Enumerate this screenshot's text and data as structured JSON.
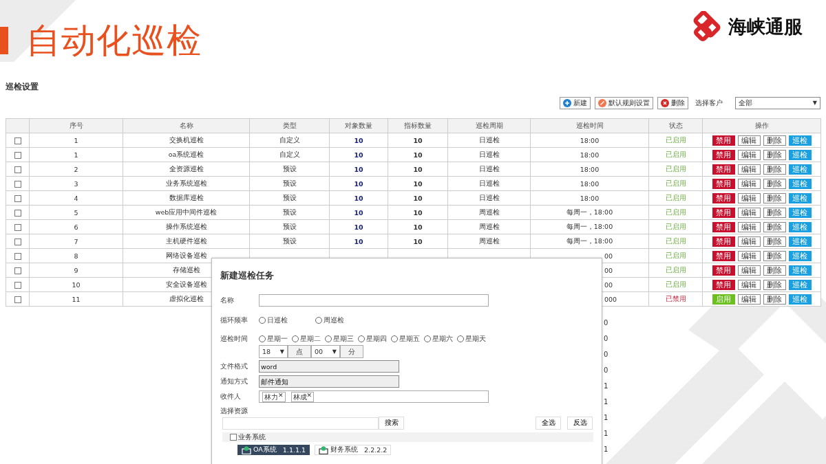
{
  "slide_title": "自动化巡检",
  "logo": {
    "text": "海峡通服"
  },
  "section_title": "巡检设置",
  "toolbar": {
    "buttons": [
      {
        "label": "新建",
        "kind": "add"
      },
      {
        "label": "默认规则设置",
        "kind": "rule"
      },
      {
        "label": "删除",
        "kind": "delete"
      }
    ],
    "customer_label": "选择客户",
    "customer_select": "全部",
    "customer_caret": "▼"
  },
  "table": {
    "columns": [
      "序号",
      "名称",
      "类型",
      "对象数量",
      "指标数量",
      "巡检周期",
      "巡检时间",
      "状态",
      "操作"
    ],
    "rows": [
      {
        "checked": false,
        "no": "1",
        "name": "交换机巡检",
        "type": "自定义",
        "objects": "10",
        "indicators": "10",
        "cycle": "日巡检",
        "time": "18:00",
        "status": "已启用",
        "enabled": true,
        "actions": [
          "禁用",
          "编辑",
          "删除",
          "巡检"
        ]
      },
      {
        "checked": false,
        "no": "1",
        "name": "oa系统巡检",
        "type": "自定义",
        "objects": "10",
        "indicators": "10",
        "cycle": "日巡检",
        "time": "18:00",
        "status": "已启用",
        "enabled": true,
        "actions": [
          "禁用",
          "编辑",
          "删除",
          "巡检"
        ]
      },
      {
        "checked": false,
        "no": "2",
        "name": "全资源巡检",
        "type": "预设",
        "objects": "10",
        "indicators": "10",
        "cycle": "日巡检",
        "time": "18:00",
        "status": "已启用",
        "enabled": true,
        "actions": [
          "禁用",
          "编辑",
          "删除",
          "巡检"
        ]
      },
      {
        "checked": false,
        "no": "3",
        "name": "业务系统巡检",
        "type": "预设",
        "objects": "10",
        "indicators": "10",
        "cycle": "日巡检",
        "time": "18:00",
        "status": "已启用",
        "enabled": true,
        "actions": [
          "禁用",
          "编辑",
          "删除",
          "巡检"
        ]
      },
      {
        "checked": false,
        "no": "4",
        "name": "数据库巡检",
        "type": "预设",
        "objects": "10",
        "indicators": "10",
        "cycle": "日巡检",
        "time": "18:00",
        "status": "已启用",
        "enabled": true,
        "actions": [
          "禁用",
          "编辑",
          "删除",
          "巡检"
        ]
      },
      {
        "checked": false,
        "no": "5",
        "name": "web应用中间件巡检",
        "type": "预设",
        "objects": "10",
        "indicators": "10",
        "cycle": "周巡检",
        "time": "每周一，18:00",
        "status": "已启用",
        "enabled": true,
        "actions": [
          "禁用",
          "编辑",
          "删除",
          "巡检"
        ]
      },
      {
        "checked": false,
        "no": "6",
        "name": "操作系统巡检",
        "type": "预设",
        "objects": "10",
        "indicators": "10",
        "cycle": "周巡检",
        "time": "每周一，18:00",
        "status": "已启用",
        "enabled": true,
        "actions": [
          "禁用",
          "编辑",
          "删除",
          "巡检"
        ]
      },
      {
        "checked": false,
        "no": "7",
        "name": "主机硬件巡检",
        "type": "预设",
        "objects": "10",
        "indicators": "10",
        "cycle": "周巡检",
        "time": "每周一，18:00",
        "status": "已启用",
        "enabled": true,
        "actions": [
          "禁用",
          "编辑",
          "删除",
          "巡检"
        ]
      },
      {
        "checked": false,
        "no": "8",
        "name": "网络设备巡检",
        "time": "00",
        "status": "已启用",
        "enabled": true,
        "actions": [
          "禁用",
          "编辑",
          "删除",
          "巡检"
        ]
      },
      {
        "checked": false,
        "no": "9",
        "name": "存储巡检",
        "time": "00",
        "status": "已启用",
        "enabled": true,
        "actions": [
          "禁用",
          "编辑",
          "删除",
          "巡检"
        ]
      },
      {
        "checked": false,
        "no": "10",
        "name": "安全设备巡检",
        "time": "00",
        "status": "已启用",
        "enabled": true,
        "actions": [
          "禁用",
          "编辑",
          "删除",
          "巡检"
        ]
      },
      {
        "checked": false,
        "no": "11",
        "name": "虚拟化巡检",
        "time": "000",
        "status": "已禁用",
        "enabled": false,
        "actions": [
          "启用",
          "编辑",
          "删除",
          "巡检"
        ]
      }
    ]
  },
  "background_fragments": [
    "0",
    "0",
    "0",
    "0",
    "1",
    "1",
    "1",
    "1",
    "1"
  ],
  "dialog": {
    "title": "新建巡检任务",
    "name_label": "名称",
    "frequency_label": "循环频率",
    "frequency_options": [
      {
        "label": "日巡检",
        "selected": false
      },
      {
        "label": "周巡检",
        "selected": false
      }
    ],
    "time_label": "巡检时间",
    "weekdays": [
      {
        "label": "星期一",
        "selected": false
      },
      {
        "label": "星期二",
        "selected": false
      },
      {
        "label": "星期三",
        "selected": false
      },
      {
        "label": "星期四",
        "selected": false
      },
      {
        "label": "星期五",
        "selected": false
      },
      {
        "label": "星期六",
        "selected": false
      },
      {
        "label": "星期天",
        "selected": false
      }
    ],
    "hour": "18",
    "hour_caret": "▼",
    "hour_unit": "点",
    "minute": "00",
    "minute_caret": "▼",
    "minute_unit": "分",
    "format_label": "文件格式",
    "format_value": "word",
    "notify_label": "通知方式",
    "notify_value": "邮件通知",
    "recipients_label": "收件人",
    "recipients": [
      "林力",
      "林成"
    ],
    "remove_glyph": "✕",
    "resource_label": "选择资源",
    "search_button": "搜索",
    "select_all": "全选",
    "invert": "反选",
    "tree": {
      "label": "业务系统",
      "checked": false,
      "items": [
        {
          "name": "OA系统",
          "ip": "1.1.1.1",
          "selected": true
        },
        {
          "name": "财务系统",
          "ip": "2.2.2.2",
          "selected": false
        }
      ]
    }
  }
}
